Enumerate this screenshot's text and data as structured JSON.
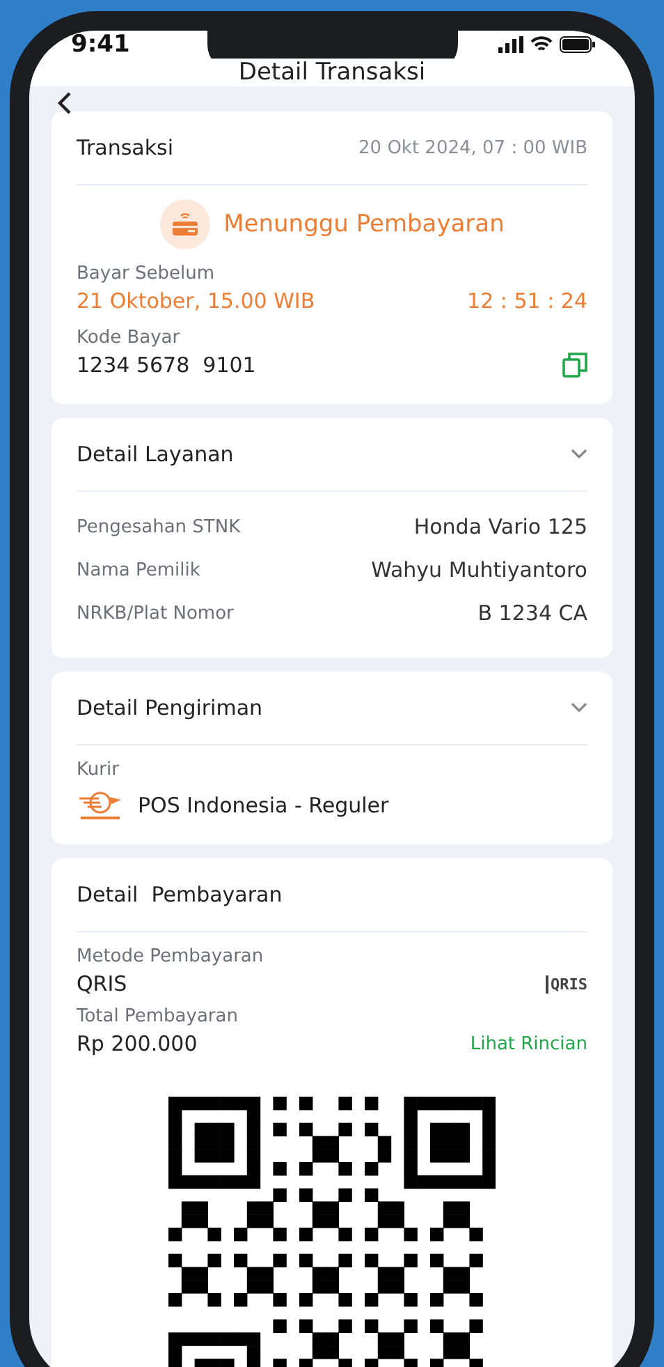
{
  "status_bar": {
    "time": "9:41"
  },
  "header": {
    "title": "Detail Transaksi"
  },
  "transaction": {
    "title": "Transaksi",
    "date": "20 Okt 2024, 07 : 00 WIB",
    "status": "Menunggu Pembayaran",
    "due_label": "Bayar Sebelum",
    "due_value": "21 Oktober, 15.00 WIB",
    "countdown": "12 : 51 : 24",
    "code_label": "Kode Bayar",
    "code_value": "1234 5678  9101"
  },
  "service": {
    "title": "Detail Layanan",
    "rows": [
      {
        "label": "Pengesahan STNK",
        "value": "Honda Vario 125"
      },
      {
        "label": "Nama Pemilik",
        "value": "Wahyu Muhtiyantoro"
      },
      {
        "label": "NRKB/Plat Nomor",
        "value": "B 1234 CA"
      }
    ]
  },
  "shipping": {
    "title": "Detail Pengiriman",
    "courier_label": "Kurir",
    "courier_value": "POS Indonesia - Reguler"
  },
  "payment": {
    "title": "Detail  Pembayaran",
    "method_label": "Metode Pembayaran",
    "method_value": "QRIS",
    "method_logo": "QRIS",
    "total_label": "Total Pembayaran",
    "total_value": "Rp 200.000",
    "details_link": "Lihat Rincian"
  }
}
